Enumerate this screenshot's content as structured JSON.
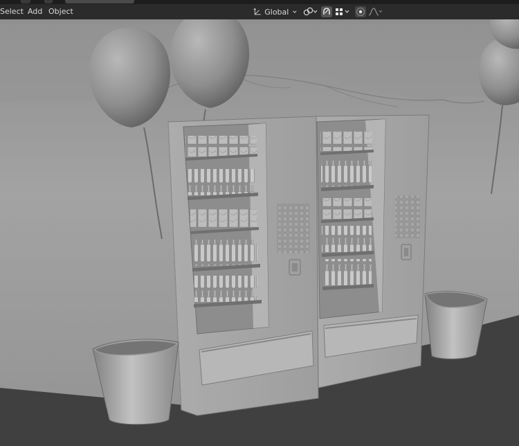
{
  "menu": {
    "select_label": "Select",
    "add_label": "Add",
    "object_label": "Object"
  },
  "transform_orientation": {
    "value": "Global",
    "icon": "transform-orientation-icon"
  },
  "toolbar_icons": [
    "pivot-link-icon",
    "snap-magnet-icon",
    "snap-grid-icon",
    "proportional-edit-icon",
    "falloff-curve-icon"
  ],
  "colors": {
    "header_bg": "#2b2b2b",
    "topbar_bg": "#1d1d1d",
    "snap_active": "#4b6a9b",
    "wall": "#9a9a9a",
    "floor": "#404040"
  }
}
